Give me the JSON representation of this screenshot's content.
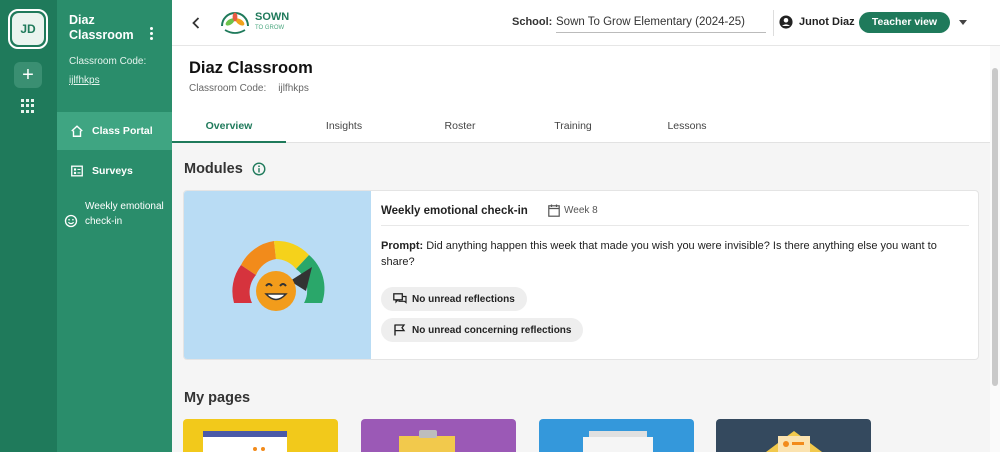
{
  "rail": {
    "avatar_initials": "JD",
    "add_label": "+"
  },
  "sidebar": {
    "title": "Diaz Classroom",
    "code_label": "Classroom Code:",
    "code": "ijlfhkps",
    "items": [
      {
        "label": "Class Portal",
        "icon": "home-icon"
      },
      {
        "label": "Surveys",
        "icon": "survey-icon"
      },
      {
        "label": "Weekly emotional check-in",
        "icon": "smiley-icon"
      }
    ]
  },
  "topbar": {
    "logo_text": "SOWN",
    "logo_sub": "TO GROW",
    "school_label": "School:",
    "school_value": "Sown To Grow Elementary (2024-25)",
    "user_name": "Junot Diaz",
    "view_button": "Teacher view"
  },
  "header": {
    "title": "Diaz Classroom",
    "code_label": "Classroom Code:",
    "code": "ijlfhkps",
    "tabs": [
      {
        "label": "Overview",
        "active": true
      },
      {
        "label": "Insights",
        "active": false
      },
      {
        "label": "Roster",
        "active": false
      },
      {
        "label": "Training",
        "active": false
      },
      {
        "label": "Lessons",
        "active": false
      }
    ]
  },
  "modules": {
    "title": "Modules",
    "card": {
      "title": "Weekly emotional check-in",
      "week": "Week 8",
      "prompt_label": "Prompt:",
      "prompt_text": "Did anything happen this week that made you wish you were invisible? Is there anything else you want to share?",
      "chips": [
        {
          "label": "No unread reflections",
          "icon": "chat-icon"
        },
        {
          "label": "No unread concerning reflections",
          "icon": "flag-icon"
        }
      ]
    }
  },
  "my_pages": {
    "title": "My pages"
  },
  "colors": {
    "brand": "#1f7a5b",
    "sidebar": "#2a8d6b",
    "tile1": "#f2c91b",
    "tile2": "#9b59b6",
    "tile3": "#3498db",
    "tile4": "#34495e"
  }
}
